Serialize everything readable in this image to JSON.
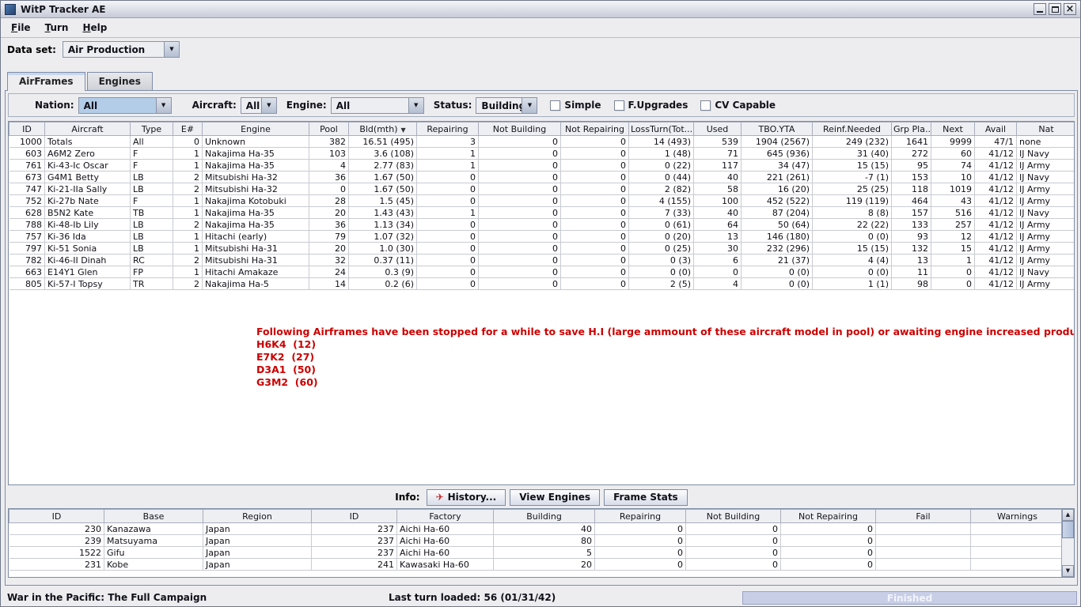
{
  "window": {
    "title": "WitP Tracker AE"
  },
  "menu": {
    "items": [
      {
        "label": "File"
      },
      {
        "label": "Turn"
      },
      {
        "label": "Help"
      }
    ]
  },
  "dataset": {
    "label": "Data set:",
    "value": "Air Production"
  },
  "tabs": {
    "airframes": "AirFrames",
    "engines": "Engines"
  },
  "filters": {
    "nation": {
      "label": "Nation:",
      "value": "All"
    },
    "aircraft": {
      "label": "Aircraft:",
      "value": "All"
    },
    "engine": {
      "label": "Engine:",
      "value": "All"
    },
    "status": {
      "label": "Status:",
      "value": "Building"
    },
    "simple": "Simple",
    "f_upgrades": "F.Upgrades",
    "cv_capable": "CV Capable"
  },
  "airframes_table": {
    "columns": [
      "ID",
      "Aircraft",
      "Type",
      "E#",
      "Engine",
      "Pool",
      "Bld(mth)",
      "Repairing",
      "Not Building",
      "Not Repairing",
      "LossTurn(Tot...",
      "Used",
      "TBO.YTA",
      "Reinf.Needed",
      "Grp Pla...",
      "Next",
      "Avail",
      "Nat"
    ],
    "sort_column": "Bld(mth)",
    "sort_direction": "descending",
    "rows": [
      [
        "1000",
        "Totals",
        "All",
        "0",
        "Unknown",
        "382",
        "16.51 (495)",
        "3",
        "0",
        "0",
        "14 (493)",
        "539",
        "1904 (2567)",
        "249 (232)",
        "1641",
        "9999",
        "47/1",
        "none"
      ],
      [
        "603",
        "A6M2 Zero",
        "F",
        "1",
        "Nakajima Ha-35",
        "103",
        "3.6 (108)",
        "1",
        "0",
        "0",
        "1 (48)",
        "71",
        "645 (936)",
        "31 (40)",
        "272",
        "60",
        "41/12",
        "IJ Navy"
      ],
      [
        "761",
        "Ki-43-Ic Oscar",
        "F",
        "1",
        "Nakajima Ha-35",
        "4",
        "2.77 (83)",
        "1",
        "0",
        "0",
        "0 (22)",
        "117",
        "34 (47)",
        "15 (15)",
        "95",
        "74",
        "41/12",
        "IJ Army"
      ],
      [
        "673",
        "G4M1 Betty",
        "LB",
        "2",
        "Mitsubishi Ha-32",
        "36",
        "1.67 (50)",
        "0",
        "0",
        "0",
        "0 (44)",
        "40",
        "221 (261)",
        "-7 (1)",
        "153",
        "10",
        "41/12",
        "IJ Navy"
      ],
      [
        "747",
        "Ki-21-IIa Sally",
        "LB",
        "2",
        "Mitsubishi Ha-32",
        "0",
        "1.67 (50)",
        "0",
        "0",
        "0",
        "2 (82)",
        "58",
        "16 (20)",
        "25 (25)",
        "118",
        "1019",
        "41/12",
        "IJ Army"
      ],
      [
        "752",
        "Ki-27b Nate",
        "F",
        "1",
        "Nakajima Kotobuki",
        "28",
        "1.5 (45)",
        "0",
        "0",
        "0",
        "4 (155)",
        "100",
        "452 (522)",
        "119 (119)",
        "464",
        "43",
        "41/12",
        "IJ Army"
      ],
      [
        "628",
        "B5N2 Kate",
        "TB",
        "1",
        "Nakajima Ha-35",
        "20",
        "1.43 (43)",
        "1",
        "0",
        "0",
        "7 (33)",
        "40",
        "87 (204)",
        "8 (8)",
        "157",
        "516",
        "41/12",
        "IJ Navy"
      ],
      [
        "788",
        "Ki-48-Ib Lily",
        "LB",
        "2",
        "Nakajima Ha-35",
        "36",
        "1.13 (34)",
        "0",
        "0",
        "0",
        "0 (61)",
        "64",
        "50 (64)",
        "22 (22)",
        "133",
        "257",
        "41/12",
        "IJ Army"
      ],
      [
        "757",
        "Ki-36 Ida",
        "LB",
        "1",
        "Hitachi (early)",
        "79",
        "1.07 (32)",
        "0",
        "0",
        "0",
        "0 (20)",
        "13",
        "146 (180)",
        "0 (0)",
        "93",
        "12",
        "41/12",
        "IJ Army"
      ],
      [
        "797",
        "Ki-51 Sonia",
        "LB",
        "1",
        "Mitsubishi Ha-31",
        "20",
        "1.0 (30)",
        "0",
        "0",
        "0",
        "0 (25)",
        "30",
        "232 (296)",
        "15 (15)",
        "132",
        "15",
        "41/12",
        "IJ Army"
      ],
      [
        "782",
        "Ki-46-II Dinah",
        "RC",
        "2",
        "Mitsubishi Ha-31",
        "32",
        "0.37 (11)",
        "0",
        "0",
        "0",
        "0 (3)",
        "6",
        "21 (37)",
        "4 (4)",
        "13",
        "1",
        "41/12",
        "IJ Army"
      ],
      [
        "663",
        "E14Y1 Glen",
        "FP",
        "1",
        "Hitachi Amakaze",
        "24",
        "0.3 (9)",
        "0",
        "0",
        "0",
        "0 (0)",
        "0",
        "0 (0)",
        "0 (0)",
        "11",
        "0",
        "41/12",
        "IJ Navy"
      ],
      [
        "805",
        "Ki-57-I Topsy",
        "TR",
        "2",
        "Nakajima Ha-5",
        "14",
        "0.2 (6)",
        "0",
        "0",
        "0",
        "2 (5)",
        "4",
        "0 (0)",
        "1 (1)",
        "98",
        "0",
        "41/12",
        "IJ Army"
      ]
    ]
  },
  "notice": {
    "heading": "Following Airframes have been stopped for a while to save H.I (large ammount of these aircraft model in pool) or awaiting engine increased production:",
    "items": [
      "H6K4  (12)",
      "E7K2  (27)",
      "D3A1  (50)",
      "G3M2  (60)"
    ]
  },
  "info_bar": {
    "label": "Info:",
    "history": "History...",
    "view_engines": "View Engines",
    "frame_stats": "Frame Stats"
  },
  "factories_table": {
    "columns": [
      "ID",
      "Base",
      "Region",
      "ID",
      "Factory",
      "Building",
      "Repairing",
      "Not Building",
      "Not Repairing",
      "Fail",
      "Warnings"
    ],
    "rows": [
      [
        "230",
        "Kanazawa",
        "Japan",
        "237",
        "Aichi Ha-60",
        "40",
        "0",
        "0",
        "0",
        "",
        ""
      ],
      [
        "239",
        "Matsuyama",
        "Japan",
        "237",
        "Aichi Ha-60",
        "80",
        "0",
        "0",
        "0",
        "",
        ""
      ],
      [
        "1522",
        "Gifu",
        "Japan",
        "237",
        "Aichi Ha-60",
        "5",
        "0",
        "0",
        "0",
        "",
        ""
      ],
      [
        "231",
        "Kobe",
        "Japan",
        "241",
        "Kawasaki Ha-60",
        "20",
        "0",
        "0",
        "0",
        "",
        ""
      ]
    ]
  },
  "status_bar": {
    "campaign": "War in the Pacific: The Full Campaign",
    "last_turn": "Last turn loaded: 56 (01/31/42)",
    "progress": "Finished"
  },
  "icons": {
    "combo_arrow": "▼",
    "sort_desc": "▼",
    "history_plane": "✈",
    "scroll_up": "▲",
    "scroll_down": "▼",
    "close": "×"
  },
  "colors": {
    "notice_red": "#CC0000",
    "selection_blue": "#B3CDE8",
    "progress_fill": "#C7CEE6"
  }
}
